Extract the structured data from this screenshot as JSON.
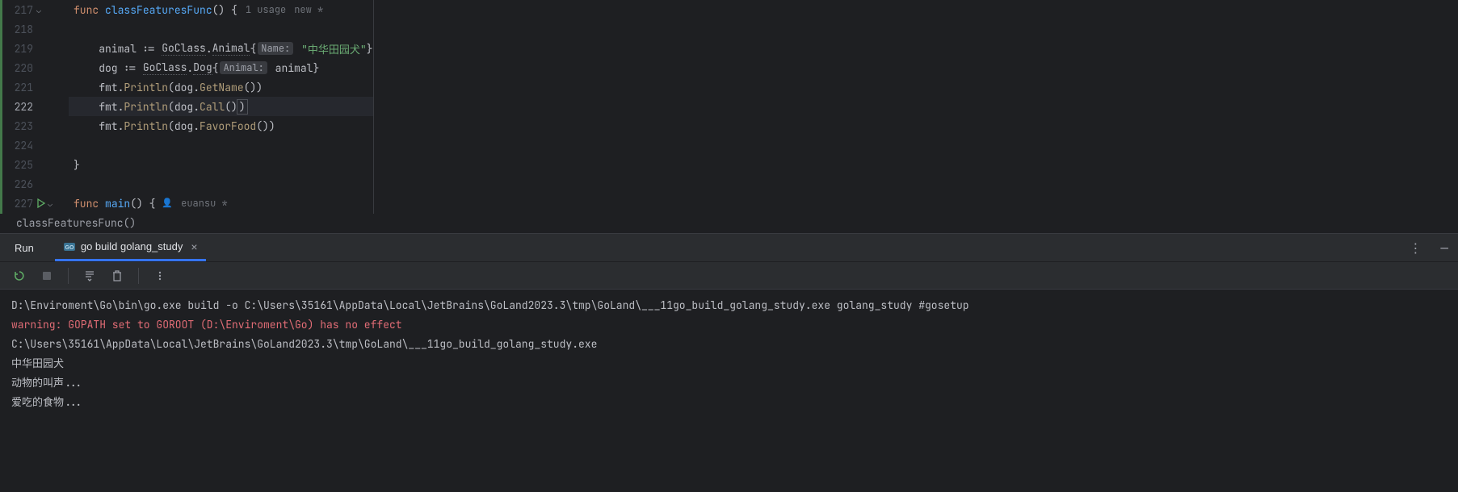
{
  "editor": {
    "lines": [
      {
        "num": "217",
        "fold": true
      },
      {
        "num": "218"
      },
      {
        "num": "219"
      },
      {
        "num": "220"
      },
      {
        "num": "221"
      },
      {
        "num": "222",
        "current": true
      },
      {
        "num": "223"
      },
      {
        "num": "224"
      },
      {
        "num": "225"
      },
      {
        "num": "226"
      },
      {
        "num": "227",
        "run": true,
        "fold": true
      }
    ],
    "code": {
      "kw_func": "func",
      "fn_classFeatures": "classFeaturesFunc",
      "sig217": "() {",
      "usage_hint": "1 usage",
      "new_hint": "new *",
      "l219_pre": "    animal := ",
      "l219_pkg": "GoClass",
      "l219_dot": ".",
      "l219_type": "Animal",
      "l219_brace": "{",
      "l219_hint": "Name:",
      "l219_str": "\"中华田园犬\"",
      "l219_end": "}",
      "l220_pre": "    dog := ",
      "l220_pkg": "GoClass",
      "l220_type": "Dog",
      "l220_brace": "{",
      "l220_hint": "Animal:",
      "l220_val": " animal}",
      "l221_pre": "    fmt.",
      "l221_fn": "Println",
      "l221_args_a": "(dog.",
      "l221_method": "GetName",
      "l221_args_b": "())",
      "l222_pre": "    fmt.",
      "l222_fn": "Println",
      "l222_args_a": "(dog.",
      "l222_method": "Call",
      "l222_args_b": "()",
      "l222_close": ")",
      "l223_pre": "    fmt.",
      "l223_fn": "Println",
      "l223_args_a": "(dog.",
      "l223_method": "FavorFood",
      "l223_args_b": "())",
      "l225": "}",
      "fn_main": "main",
      "sig227": "() {",
      "author": "euansu *"
    }
  },
  "breadcrumb": {
    "text": "classFeaturesFunc()"
  },
  "runPanel": {
    "title": "Run",
    "tab": "go build golang_study"
  },
  "console": {
    "l1": "D:\\Enviroment\\Go\\bin\\go.exe build -o C:\\Users\\35161\\AppData\\Local\\JetBrains\\GoLand2023.3\\tmp\\GoLand\\___11go_build_golang_study.exe golang_study #gosetup",
    "l2": "warning: GOPATH set to GOROOT (D:\\Enviroment\\Go) has no effect",
    "l3": "C:\\Users\\35161\\AppData\\Local\\JetBrains\\GoLand2023.3\\tmp\\GoLand\\___11go_build_golang_study.exe",
    "l4": "中华田园犬",
    "l5": "动物的叫声...",
    "l6": "爱吃的食物..."
  }
}
